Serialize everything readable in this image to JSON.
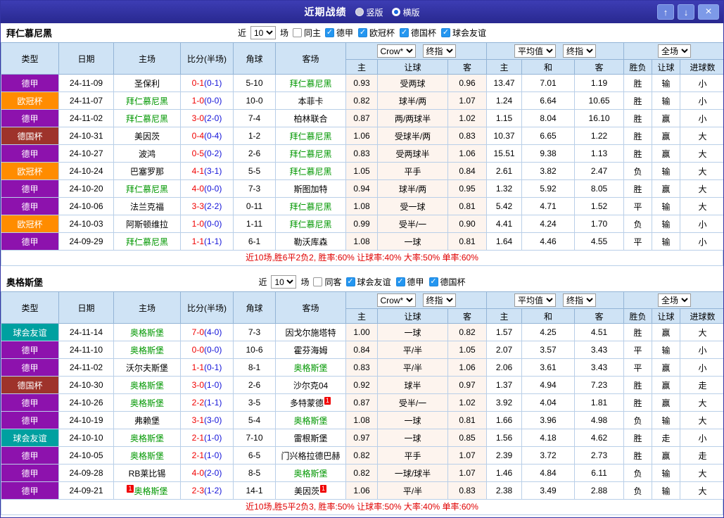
{
  "titlebar": {
    "title": "近期战绩",
    "view_vertical": "竖版",
    "view_horizontal": "横版",
    "selected_view": "横版",
    "up_icon": "↑",
    "down_icon": "↓",
    "close_icon": "×"
  },
  "header": {
    "near": "近",
    "games": "场",
    "cols_left": [
      "类型",
      "日期",
      "主场",
      "比分(半场)",
      "角球",
      "客场"
    ],
    "odds_select": "Crow*",
    "odds_final": "终指",
    "odds_cols": [
      "主",
      "让球",
      "客"
    ],
    "avg_select": "平均值",
    "avg_final": "终指",
    "avg_cols": [
      "主",
      "和",
      "客"
    ],
    "scope_select": "全场",
    "result_cols": [
      "胜负",
      "让球",
      "进球数"
    ]
  },
  "league_colors": {
    "德甲": "#8d12ad",
    "欧冠杯": "#ff8c00",
    "德国杯": "#9e332b",
    "球会友谊": "#00a0a0"
  },
  "result_colors": {
    "red": "#f00000",
    "blue": "#0b0bd8",
    "green": "#00963c"
  },
  "accent_colors": {
    "self_team_green": "#009700",
    "score_ft_red": "#f00000",
    "score_ht_blue": "#1212d8",
    "header_blue": "#cfe3f5",
    "titlebar_blue": "#2d2d9e"
  },
  "sections": [
    {
      "team": "拜仁慕尼黑",
      "filter": {
        "count": "10",
        "same": "同主",
        "same_checked": false,
        "leagues": [
          "德甲",
          "欧冠杯",
          "德国杯",
          "球会友谊"
        ]
      },
      "rows": [
        {
          "league": "德甲",
          "date": "24-11-09",
          "home": "圣保利",
          "home_self": false,
          "home_badge": "",
          "score_ft": "0-1",
          "score_ht": "(0-1)",
          "corners": "5-10",
          "away": "拜仁慕尼黑",
          "away_self": true,
          "away_badge": "",
          "odds": [
            "0.93",
            "受两球",
            "0.96"
          ],
          "avg": [
            "13.47",
            "7.01",
            "1.19"
          ],
          "results": [
            [
              "胜",
              "red"
            ],
            [
              "输",
              "blue"
            ],
            [
              "小",
              "red"
            ]
          ]
        },
        {
          "league": "欧冠杯",
          "date": "24-11-07",
          "home": "拜仁慕尼黑",
          "home_self": true,
          "home_badge": "",
          "score_ft": "1-0",
          "score_ht": "(0-0)",
          "corners": "10-0",
          "away": "本菲卡",
          "away_self": false,
          "away_badge": "",
          "odds": [
            "0.82",
            "球半/两",
            "1.07"
          ],
          "avg": [
            "1.24",
            "6.64",
            "10.65"
          ],
          "results": [
            [
              "胜",
              "red"
            ],
            [
              "输",
              "blue"
            ],
            [
              "小",
              "red"
            ]
          ]
        },
        {
          "league": "德甲",
          "date": "24-11-02",
          "home": "拜仁慕尼黑",
          "home_self": true,
          "home_badge": "",
          "score_ft": "3-0",
          "score_ht": "(2-0)",
          "corners": "7-4",
          "away": "柏林联合",
          "away_self": false,
          "away_badge": "",
          "odds": [
            "0.87",
            "两/两球半",
            "1.02"
          ],
          "avg": [
            "1.15",
            "8.04",
            "16.10"
          ],
          "results": [
            [
              "胜",
              "red"
            ],
            [
              "赢",
              "red"
            ],
            [
              "小",
              "red"
            ]
          ]
        },
        {
          "league": "德国杯",
          "date": "24-10-31",
          "home": "美因茨",
          "home_self": false,
          "home_badge": "",
          "score_ft": "0-4",
          "score_ht": "(0-4)",
          "corners": "1-2",
          "away": "拜仁慕尼黑",
          "away_self": true,
          "away_badge": "",
          "odds": [
            "1.06",
            "受球半/两",
            "0.83"
          ],
          "avg": [
            "10.37",
            "6.65",
            "1.22"
          ],
          "results": [
            [
              "胜",
              "red"
            ],
            [
              "赢",
              "red"
            ],
            [
              "大",
              "red"
            ]
          ]
        },
        {
          "league": "德甲",
          "date": "24-10-27",
          "home": "波鸿",
          "home_self": false,
          "home_badge": "",
          "score_ft": "0-5",
          "score_ht": "(0-2)",
          "corners": "2-6",
          "away": "拜仁慕尼黑",
          "away_self": true,
          "away_badge": "",
          "odds": [
            "0.83",
            "受两球半",
            "1.06"
          ],
          "avg": [
            "15.51",
            "9.38",
            "1.13"
          ],
          "results": [
            [
              "胜",
              "red"
            ],
            [
              "赢",
              "red"
            ],
            [
              "大",
              "red"
            ]
          ]
        },
        {
          "league": "欧冠杯",
          "date": "24-10-24",
          "home": "巴塞罗那",
          "home_self": false,
          "home_badge": "",
          "score_ft": "4-1",
          "score_ht": "(3-1)",
          "corners": "5-5",
          "away": "拜仁慕尼黑",
          "away_self": true,
          "away_badge": "",
          "odds": [
            "1.05",
            "平手",
            "0.84"
          ],
          "avg": [
            "2.61",
            "3.82",
            "2.47"
          ],
          "results": [
            [
              "负",
              "blue"
            ],
            [
              "输",
              "blue"
            ],
            [
              "大",
              "red"
            ]
          ]
        },
        {
          "league": "德甲",
          "date": "24-10-20",
          "home": "拜仁慕尼黑",
          "home_self": true,
          "home_badge": "",
          "score_ft": "4-0",
          "score_ht": "(0-0)",
          "corners": "7-3",
          "away": "斯图加特",
          "away_self": false,
          "away_badge": "",
          "odds": [
            "0.94",
            "球半/两",
            "0.95"
          ],
          "avg": [
            "1.32",
            "5.92",
            "8.05"
          ],
          "results": [
            [
              "胜",
              "red"
            ],
            [
              "赢",
              "red"
            ],
            [
              "大",
              "red"
            ]
          ]
        },
        {
          "league": "德甲",
          "date": "24-10-06",
          "home": "法兰克福",
          "home_self": false,
          "home_badge": "",
          "score_ft": "3-3",
          "score_ht": "(2-2)",
          "corners": "0-11",
          "away": "拜仁慕尼黑",
          "away_self": true,
          "away_badge": "",
          "odds": [
            "1.08",
            "受一球",
            "0.81"
          ],
          "avg": [
            "5.42",
            "4.71",
            "1.52"
          ],
          "results": [
            [
              "平",
              "green"
            ],
            [
              "输",
              "blue"
            ],
            [
              "大",
              "red"
            ]
          ]
        },
        {
          "league": "欧冠杯",
          "date": "24-10-03",
          "home": "阿斯顿维拉",
          "home_self": false,
          "home_badge": "",
          "score_ft": "1-0",
          "score_ht": "(0-0)",
          "corners": "1-11",
          "away": "拜仁慕尼黑",
          "away_self": true,
          "away_badge": "",
          "odds": [
            "0.99",
            "受半/一",
            "0.90"
          ],
          "avg": [
            "4.41",
            "4.24",
            "1.70"
          ],
          "results": [
            [
              "负",
              "blue"
            ],
            [
              "输",
              "blue"
            ],
            [
              "小",
              "red"
            ]
          ]
        },
        {
          "league": "德甲",
          "date": "24-09-29",
          "home": "拜仁慕尼黑",
          "home_self": true,
          "home_badge": "",
          "score_ft": "1-1",
          "score_ht": "(1-1)",
          "corners": "6-1",
          "away": "勒沃库森",
          "away_self": false,
          "away_badge": "",
          "odds": [
            "1.08",
            "一球",
            "0.81"
          ],
          "avg": [
            "1.64",
            "4.46",
            "4.55"
          ],
          "results": [
            [
              "平",
              "green"
            ],
            [
              "输",
              "blue"
            ],
            [
              "小",
              "red"
            ]
          ]
        }
      ],
      "summary": "近10场,胜6平2负2, 胜率:60% 让球率:40% 大率:50% 单率:60%"
    },
    {
      "team": "奥格斯堡",
      "filter": {
        "count": "10",
        "same": "同客",
        "same_checked": false,
        "leagues": [
          "球会友谊",
          "德甲",
          "德国杯"
        ]
      },
      "rows": [
        {
          "league": "球会友谊",
          "date": "24-11-14",
          "home": "奥格斯堡",
          "home_self": true,
          "home_badge": "",
          "score_ft": "7-0",
          "score_ht": "(4-0)",
          "corners": "7-3",
          "away": "因戈尔施塔特",
          "away_self": false,
          "away_badge": "",
          "odds": [
            "1.00",
            "一球",
            "0.82"
          ],
          "avg": [
            "1.57",
            "4.25",
            "4.51"
          ],
          "results": [
            [
              "胜",
              "red"
            ],
            [
              "赢",
              "red"
            ],
            [
              "大",
              "red"
            ]
          ]
        },
        {
          "league": "德甲",
          "date": "24-11-10",
          "home": "奥格斯堡",
          "home_self": true,
          "home_badge": "",
          "score_ft": "0-0",
          "score_ht": "(0-0)",
          "corners": "10-6",
          "away": "霍芬海姆",
          "away_self": false,
          "away_badge": "",
          "odds": [
            "0.84",
            "平/半",
            "1.05"
          ],
          "avg": [
            "2.07",
            "3.57",
            "3.43"
          ],
          "results": [
            [
              "平",
              "green"
            ],
            [
              "输",
              "blue"
            ],
            [
              "小",
              "red"
            ]
          ]
        },
        {
          "league": "德甲",
          "date": "24-11-02",
          "home": "沃尔夫斯堡",
          "home_self": false,
          "home_badge": "",
          "score_ft": "1-1",
          "score_ht": "(0-1)",
          "corners": "8-1",
          "away": "奥格斯堡",
          "away_self": true,
          "away_badge": "",
          "odds": [
            "0.83",
            "平/半",
            "1.06"
          ],
          "avg": [
            "2.06",
            "3.61",
            "3.43"
          ],
          "results": [
            [
              "平",
              "green"
            ],
            [
              "赢",
              "red"
            ],
            [
              "小",
              "red"
            ]
          ]
        },
        {
          "league": "德国杯",
          "date": "24-10-30",
          "home": "奥格斯堡",
          "home_self": true,
          "home_badge": "",
          "score_ft": "3-0",
          "score_ht": "(1-0)",
          "corners": "2-6",
          "away": "沙尔克04",
          "away_self": false,
          "away_badge": "",
          "odds": [
            "0.92",
            "球半",
            "0.97"
          ],
          "avg": [
            "1.37",
            "4.94",
            "7.23"
          ],
          "results": [
            [
              "胜",
              "red"
            ],
            [
              "赢",
              "red"
            ],
            [
              "走",
              "green"
            ]
          ]
        },
        {
          "league": "德甲",
          "date": "24-10-26",
          "home": "奥格斯堡",
          "home_self": true,
          "home_badge": "",
          "score_ft": "2-2",
          "score_ht": "(1-1)",
          "corners": "3-5",
          "away": "多特蒙德",
          "away_self": false,
          "away_badge": "1",
          "odds": [
            "0.87",
            "受半/一",
            "1.02"
          ],
          "avg": [
            "3.92",
            "4.04",
            "1.81"
          ],
          "results": [
            [
              "胜",
              "red"
            ],
            [
              "赢",
              "red"
            ],
            [
              "大",
              "red"
            ]
          ]
        },
        {
          "league": "德甲",
          "date": "24-10-19",
          "home": "弗赖堡",
          "home_self": false,
          "home_badge": "",
          "score_ft": "3-1",
          "score_ht": "(3-0)",
          "corners": "5-4",
          "away": "奥格斯堡",
          "away_self": true,
          "away_badge": "",
          "odds": [
            "1.08",
            "一球",
            "0.81"
          ],
          "avg": [
            "1.66",
            "3.96",
            "4.98"
          ],
          "results": [
            [
              "负",
              "blue"
            ],
            [
              "输",
              "blue"
            ],
            [
              "大",
              "red"
            ]
          ]
        },
        {
          "league": "球会友谊",
          "date": "24-10-10",
          "home": "奥格斯堡",
          "home_self": true,
          "home_badge": "",
          "score_ft": "2-1",
          "score_ht": "(1-0)",
          "corners": "7-10",
          "away": "雷根斯堡",
          "away_self": false,
          "away_badge": "",
          "odds": [
            "0.97",
            "一球",
            "0.85"
          ],
          "avg": [
            "1.56",
            "4.18",
            "4.62"
          ],
          "results": [
            [
              "胜",
              "red"
            ],
            [
              "走",
              "green"
            ],
            [
              "小",
              "red"
            ]
          ]
        },
        {
          "league": "德甲",
          "date": "24-10-05",
          "home": "奥格斯堡",
          "home_self": true,
          "home_badge": "",
          "score_ft": "2-1",
          "score_ht": "(1-0)",
          "corners": "6-5",
          "away": "门兴格拉德巴赫",
          "away_self": false,
          "away_badge": "",
          "odds": [
            "0.82",
            "平手",
            "1.07"
          ],
          "avg": [
            "2.39",
            "3.72",
            "2.73"
          ],
          "results": [
            [
              "胜",
              "red"
            ],
            [
              "赢",
              "red"
            ],
            [
              "走",
              "green"
            ]
          ]
        },
        {
          "league": "德甲",
          "date": "24-09-28",
          "home": "RB莱比锡",
          "home_self": false,
          "home_badge": "",
          "score_ft": "4-0",
          "score_ht": "(2-0)",
          "corners": "8-5",
          "away": "奥格斯堡",
          "away_self": true,
          "away_badge": "",
          "odds": [
            "0.82",
            "一球/球半",
            "1.07"
          ],
          "avg": [
            "1.46",
            "4.84",
            "6.11"
          ],
          "results": [
            [
              "负",
              "blue"
            ],
            [
              "输",
              "blue"
            ],
            [
              "大",
              "red"
            ]
          ]
        },
        {
          "league": "德甲",
          "date": "24-09-21",
          "home": "奥格斯堡",
          "home_self": true,
          "home_badge": "1",
          "score_ft": "2-3",
          "score_ht": "(1-2)",
          "corners": "14-1",
          "away": "美因茨",
          "away_self": false,
          "away_badge": "1",
          "odds": [
            "1.06",
            "平/半",
            "0.83"
          ],
          "avg": [
            "2.38",
            "3.49",
            "2.88"
          ],
          "results": [
            [
              "负",
              "blue"
            ],
            [
              "输",
              "blue"
            ],
            [
              "大",
              "red"
            ]
          ]
        }
      ],
      "summary": "近10场,胜5平2负3, 胜率:50% 让球率:50% 大率:40% 单率:60%"
    }
  ]
}
